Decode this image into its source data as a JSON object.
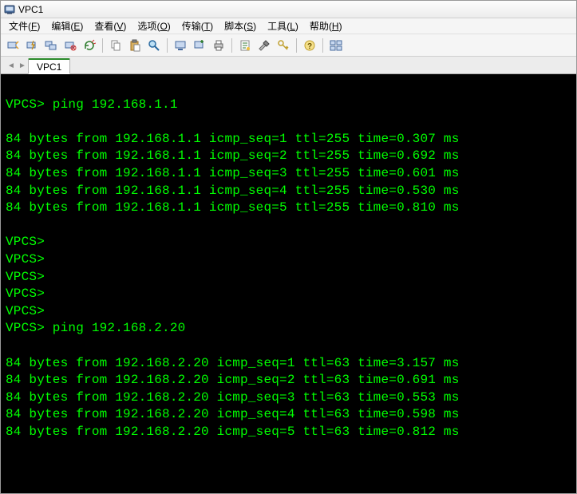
{
  "window": {
    "title": "VPC1"
  },
  "menubar": {
    "items": [
      {
        "label": "文件",
        "key": "F"
      },
      {
        "label": "编辑",
        "key": "E"
      },
      {
        "label": "查看",
        "key": "V"
      },
      {
        "label": "选项",
        "key": "O"
      },
      {
        "label": "传输",
        "key": "T"
      },
      {
        "label": "脚本",
        "key": "S"
      },
      {
        "label": "工具",
        "key": "L"
      },
      {
        "label": "帮助",
        "key": "H"
      }
    ]
  },
  "tabs": {
    "active": "VPC1"
  },
  "terminal": {
    "prompt": "VPCS>",
    "lines": [
      "",
      "VPCS> ping 192.168.1.1",
      "",
      "84 bytes from 192.168.1.1 icmp_seq=1 ttl=255 time=0.307 ms",
      "84 bytes from 192.168.1.1 icmp_seq=2 ttl=255 time=0.692 ms",
      "84 bytes from 192.168.1.1 icmp_seq=3 ttl=255 time=0.601 ms",
      "84 bytes from 192.168.1.1 icmp_seq=4 ttl=255 time=0.530 ms",
      "84 bytes from 192.168.1.1 icmp_seq=5 ttl=255 time=0.810 ms",
      "",
      "VPCS>",
      "VPCS>",
      "VPCS>",
      "VPCS>",
      "VPCS>",
      "VPCS> ping 192.168.2.20",
      "",
      "84 bytes from 192.168.2.20 icmp_seq=1 ttl=63 time=3.157 ms",
      "84 bytes from 192.168.2.20 icmp_seq=2 ttl=63 time=0.691 ms",
      "84 bytes from 192.168.2.20 icmp_seq=3 ttl=63 time=0.553 ms",
      "84 bytes from 192.168.2.20 icmp_seq=4 ttl=63 time=0.598 ms",
      "84 bytes from 192.168.2.20 icmp_seq=5 ttl=63 time=0.812 ms"
    ]
  }
}
